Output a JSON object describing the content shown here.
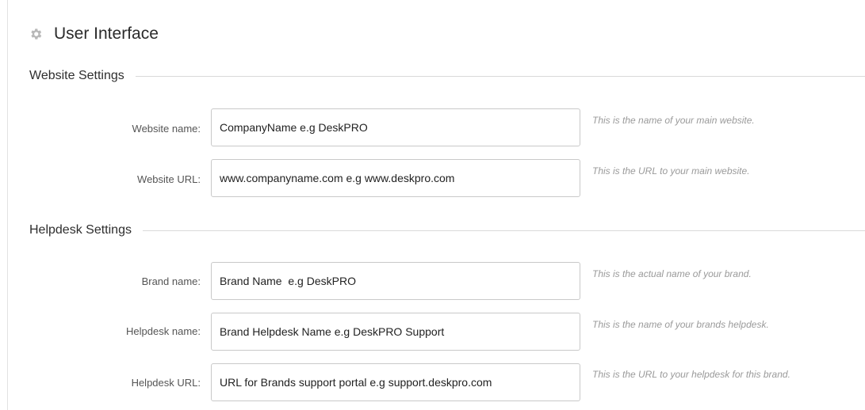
{
  "header": {
    "title": "User Interface",
    "icon": "gear-icon"
  },
  "sections": [
    {
      "title": "Website Settings",
      "fields": [
        {
          "label": "Website name:",
          "value": "CompanyName e.g DeskPRO",
          "hint": "This is the name of your main website."
        },
        {
          "label": "Website URL:",
          "value": "www.companyname.com e.g www.deskpro.com",
          "hint": "This is the URL to your main website."
        }
      ]
    },
    {
      "title": "Helpdesk Settings",
      "fields": [
        {
          "label": "Brand name:",
          "value": "Brand Name  e.g DeskPRO",
          "hint": "This is the actual name of your brand."
        },
        {
          "label": "Helpdesk name:",
          "value": "Brand Helpdesk Name e.g DeskPRO Support",
          "hint": "This is the name of your brands helpdesk."
        },
        {
          "label": "Helpdesk URL:",
          "value": "URL for Brands support portal e.g support.deskpro.com",
          "hint": "This is the URL to your helpdesk for this brand."
        }
      ]
    }
  ]
}
